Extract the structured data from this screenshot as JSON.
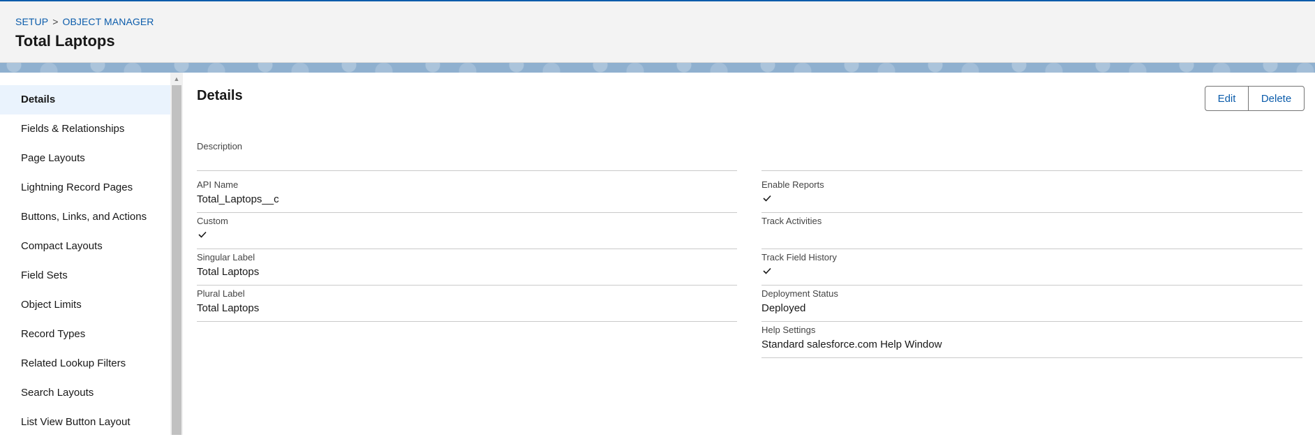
{
  "header": {
    "breadcrumb": {
      "setup": "SETUP",
      "separator": ">",
      "object_manager": "OBJECT MANAGER"
    },
    "title": "Total Laptops"
  },
  "sidebar": {
    "items": [
      {
        "label": "Details",
        "active": true
      },
      {
        "label": "Fields & Relationships"
      },
      {
        "label": "Page Layouts"
      },
      {
        "label": "Lightning Record Pages"
      },
      {
        "label": "Buttons, Links, and Actions"
      },
      {
        "label": "Compact Layouts"
      },
      {
        "label": "Field Sets"
      },
      {
        "label": "Object Limits"
      },
      {
        "label": "Record Types"
      },
      {
        "label": "Related Lookup Filters"
      },
      {
        "label": "Search Layouts"
      },
      {
        "label": "List View Button Layout"
      }
    ]
  },
  "main": {
    "section_title": "Details",
    "edit_label": "Edit",
    "delete_label": "Delete",
    "fields": {
      "description": {
        "label": "Description",
        "value": ""
      },
      "api_name": {
        "label": "API Name",
        "value": "Total_Laptops__c"
      },
      "custom": {
        "label": "Custom",
        "checked": true
      },
      "singular_label": {
        "label": "Singular Label",
        "value": "Total Laptops"
      },
      "plural_label": {
        "label": "Plural Label",
        "value": "Total Laptops"
      },
      "enable_reports": {
        "label": "Enable Reports",
        "checked": true
      },
      "track_activities": {
        "label": "Track Activities",
        "checked": false
      },
      "track_field_history": {
        "label": "Track Field History",
        "checked": true
      },
      "deployment_status": {
        "label": "Deployment Status",
        "value": "Deployed"
      },
      "help_settings": {
        "label": "Help Settings",
        "value": "Standard salesforce.com Help Window"
      }
    }
  },
  "colors": {
    "accent": "#0b5cab",
    "header_bg": "#f3f3f3",
    "banner": "#8fb0cf",
    "active_nav_bg": "#eaf3fd"
  },
  "icons": {
    "check": "checkmark-icon",
    "scroll_up": "scroll-up-arrow-icon"
  }
}
